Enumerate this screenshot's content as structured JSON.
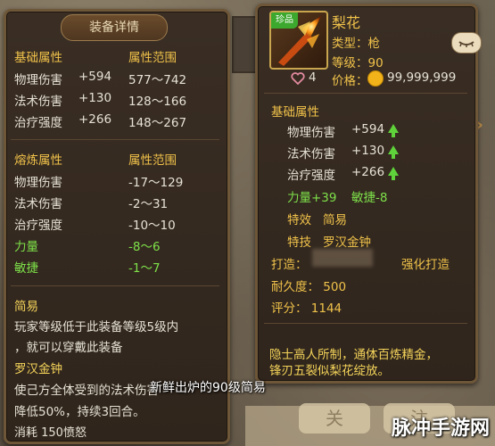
{
  "detail_panel": {
    "header": "装备详情",
    "base_section": {
      "attr_header": "基础属性",
      "range_header": "属性范围",
      "rows": [
        {
          "name": "物理伤害",
          "value": "+594",
          "range": "577～742"
        },
        {
          "name": "法术伤害",
          "value": "+130",
          "range": "128～166"
        },
        {
          "name": "治疗强度",
          "value": "+266",
          "range": "148～267"
        }
      ]
    },
    "refine_section": {
      "attr_header": "熔炼属性",
      "range_header": "属性范围",
      "rows": [
        {
          "name": "物理伤害",
          "range": "-17～129"
        },
        {
          "name": "法术伤害",
          "range": "-2～31"
        },
        {
          "name": "治疗强度",
          "range": "-10～10"
        },
        {
          "name": "力量",
          "range": "-8～6"
        },
        {
          "name": "敏捷",
          "range": "-1～7"
        }
      ]
    },
    "effect_name": "简易",
    "effect_desc_1": "玩家等级低于此装备等级5级内",
    "effect_desc_2": "，就可以穿戴此装备",
    "skill_name": "罗汉金钟",
    "skill_desc_1": "使己方全体受到的法术伤害",
    "skill_desc_2": "降低50%，持续3回合。",
    "consume": "消耗  150愤怒"
  },
  "item_panel": {
    "name": "梨花",
    "rarity_badge": "珍品",
    "type_label": "类型：枪",
    "level_label": "等级：90",
    "likes": "4",
    "price_label": "价格：",
    "price": "99,999,999",
    "base_header": "基础属性",
    "stats": [
      {
        "name": "物理伤害",
        "value": "+594"
      },
      {
        "name": "法术伤害",
        "value": "+130"
      },
      {
        "name": "治疗强度",
        "value": "+266"
      }
    ],
    "strength": "力量+39",
    "agility": "敏捷-8",
    "effect_label": "特效",
    "effect_value": "简易",
    "skill_label": "特技",
    "skill_value": "罗汉金钟",
    "forge_label": "打造：",
    "forge_button": "强化打造",
    "durability": "耐久度：  500",
    "score": "评分：  1144",
    "desc_1": "隐士高人所制，通体百炼精金，",
    "desc_2": "锋刃五裂似梨花绽放。"
  },
  "background": {
    "btn_left": "关",
    "btn_right": "注"
  },
  "caption": "新鲜出炉的90级简易",
  "watermark": "脉冲手游网"
}
